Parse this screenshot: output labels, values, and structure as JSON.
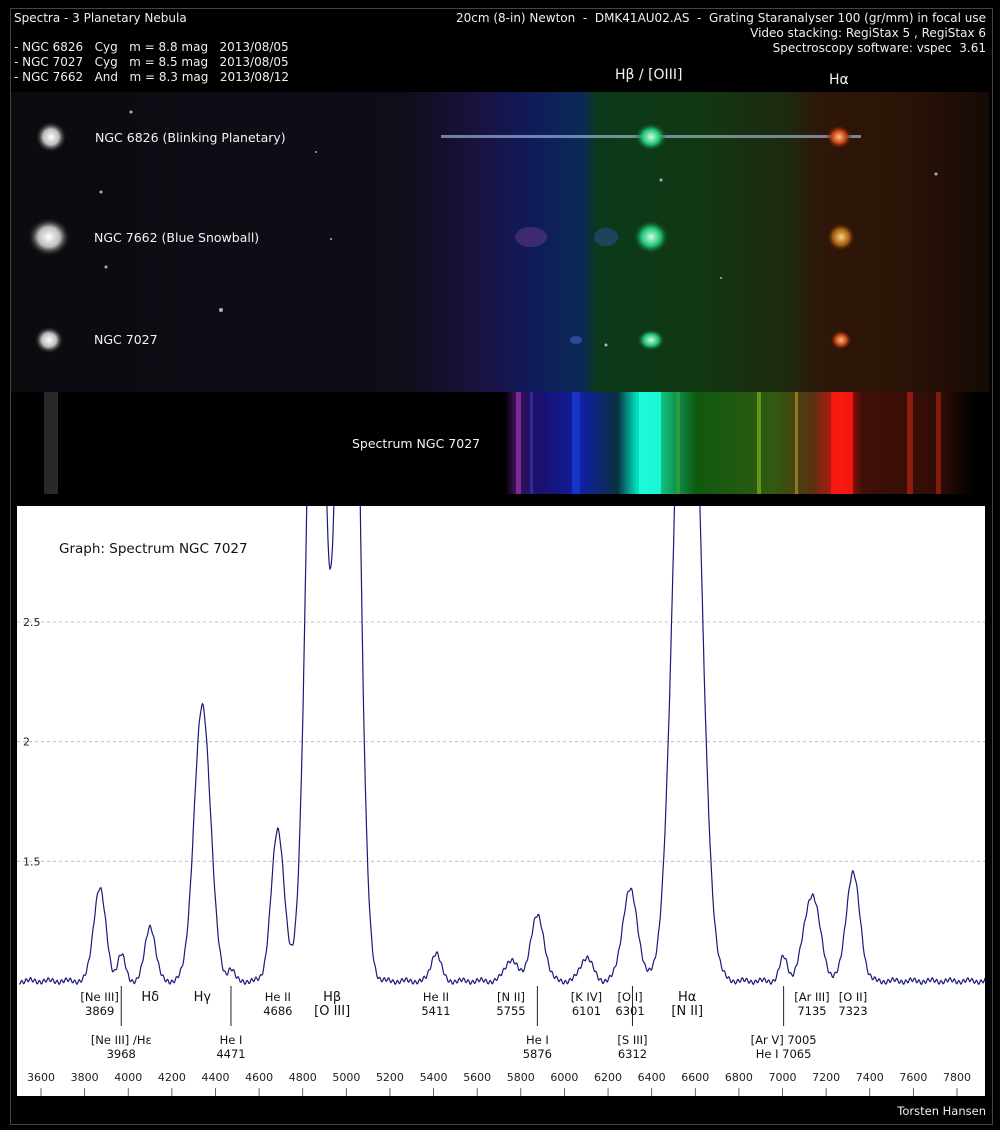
{
  "header": {
    "title": "Spectra - 3 Planetary Nebula",
    "objects": [
      "- NGC 6826   Cyg   m = 8.8 mag   2013/08/05",
      "- NGC 7027   Cyg   m = 8.5 mag   2013/08/05",
      "- NGC 7662   And   m = 8.3 mag   2013/08/12"
    ],
    "equipment": [
      "20cm (8-in) Newton  -  DMK41AU02.AS  -  Grating Staranalyser 100 (gr/mm) in focal use",
      "Video stacking: RegiStax 5 , RegiStax 6",
      "Spectroscopy software: vspec  3.61"
    ]
  },
  "strips": {
    "hbeta_oiii": "Hβ / [OIII]",
    "halpha": "Hα",
    "ngc6826": "NGC 6826 (Blinking Planetary)",
    "ngc7662": "NGC 7662 (Blue Snowball)",
    "ngc7027": "NGC 7027",
    "spectrum_label": "Spectrum NGC 7027"
  },
  "colors": {
    "curve": "#1a1a7a",
    "plot_bg": "#ffffff",
    "grid": "#b0b0b0"
  },
  "chart_data": {
    "type": "line",
    "title": "Graph: Spectrum NGC 7027",
    "xlabel": "",
    "ylabel": "",
    "xlim": [
      3500,
      8000
    ],
    "ylim": [
      0.85,
      2.9
    ],
    "xticks": [
      3600,
      3800,
      4000,
      4200,
      4400,
      4600,
      4800,
      5000,
      5200,
      5400,
      5600,
      5800,
      6000,
      6200,
      6400,
      6600,
      6800,
      7000,
      7200,
      7400,
      7600,
      7800
    ],
    "yticks": [
      1.5,
      2,
      2.5
    ],
    "grid": "horizontal dashed",
    "baseline": 1.0,
    "peaks": [
      {
        "x": 3869,
        "y": 1.39,
        "w": 28
      },
      {
        "x": 3968,
        "y": 1.11,
        "w": 18
      },
      {
        "x": 4101,
        "y": 1.23,
        "w": 24
      },
      {
        "x": 4340,
        "y": 2.15,
        "w": 38
      },
      {
        "x": 4471,
        "y": 1.05,
        "w": 15
      },
      {
        "x": 4686,
        "y": 1.63,
        "w": 30
      },
      {
        "x": 4861,
        "y": 4.5,
        "w": 40
      },
      {
        "x": 5007,
        "y": 6.0,
        "w": 42
      },
      {
        "x": 5411,
        "y": 1.12,
        "w": 22
      },
      {
        "x": 5755,
        "y": 1.09,
        "w": 28
      },
      {
        "x": 5876,
        "y": 1.27,
        "w": 32
      },
      {
        "x": 6101,
        "y": 1.1,
        "w": 28
      },
      {
        "x": 6301,
        "y": 1.38,
        "w": 35
      },
      {
        "x": 6563,
        "y": 4.5,
        "w": 55
      },
      {
        "x": 7005,
        "y": 1.1,
        "w": 18
      },
      {
        "x": 7135,
        "y": 1.36,
        "w": 38
      },
      {
        "x": 7323,
        "y": 1.45,
        "w": 32
      }
    ],
    "annotations": [
      {
        "x": 3869,
        "line1": "[Ne III]",
        "line2": "3869",
        "row": "upper"
      },
      {
        "x": 4101,
        "line1": "Hδ",
        "line2": "",
        "row": "upper"
      },
      {
        "x": 4340,
        "line1": "Hγ",
        "line2": "",
        "row": "upper"
      },
      {
        "x": 4686,
        "line1": "He II",
        "line2": "4686",
        "row": "upper"
      },
      {
        "x": 4935,
        "line1": "Hβ",
        "line2": "[O III]",
        "row": "upper"
      },
      {
        "x": 5411,
        "line1": "He II",
        "line2": "5411",
        "row": "upper"
      },
      {
        "x": 5755,
        "line1": "[N II]",
        "line2": "5755",
        "row": "upper"
      },
      {
        "x": 6101,
        "line1": "[K IV]",
        "line2": "6101",
        "row": "upper"
      },
      {
        "x": 6301,
        "line1": "[O I]",
        "line2": "6301",
        "row": "upper"
      },
      {
        "x": 6563,
        "line1": "Hα",
        "line2": "[N II]",
        "row": "upper"
      },
      {
        "x": 7135,
        "line1": "[Ar III]",
        "line2": "7135",
        "row": "upper"
      },
      {
        "x": 7323,
        "line1": "[O II]",
        "line2": "7323",
        "row": "upper"
      },
      {
        "x": 3968,
        "line1": "[Ne III] /Hε",
        "line2": "3968",
        "row": "lower"
      },
      {
        "x": 4471,
        "line1": "He I",
        "line2": "4471",
        "row": "lower"
      },
      {
        "x": 5876,
        "line1": "He I",
        "line2": "5876",
        "row": "lower"
      },
      {
        "x": 6312,
        "line1": "[S III]",
        "line2": "6312",
        "row": "lower"
      },
      {
        "x": 7005,
        "line1": "[Ar V] 7005",
        "line2": "He I 7065",
        "row": "lower"
      }
    ]
  },
  "credit": "Torsten Hansen"
}
